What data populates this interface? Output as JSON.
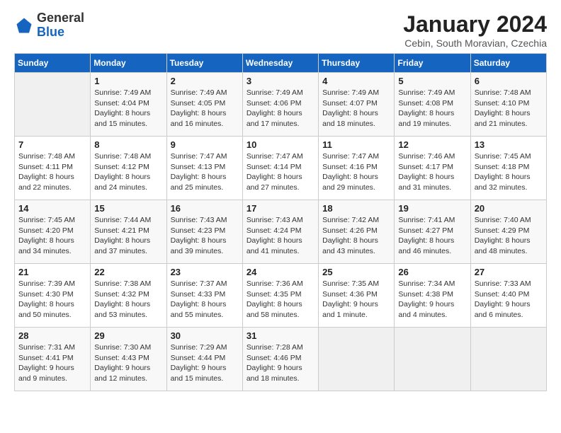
{
  "header": {
    "logo": {
      "general": "General",
      "blue": "Blue"
    },
    "title": "January 2024",
    "subtitle": "Cebin, South Moravian, Czechia"
  },
  "days_of_week": [
    "Sunday",
    "Monday",
    "Tuesday",
    "Wednesday",
    "Thursday",
    "Friday",
    "Saturday"
  ],
  "weeks": [
    [
      {
        "day": "",
        "info": ""
      },
      {
        "day": "1",
        "info": "Sunrise: 7:49 AM\nSunset: 4:04 PM\nDaylight: 8 hours\nand 15 minutes."
      },
      {
        "day": "2",
        "info": "Sunrise: 7:49 AM\nSunset: 4:05 PM\nDaylight: 8 hours\nand 16 minutes."
      },
      {
        "day": "3",
        "info": "Sunrise: 7:49 AM\nSunset: 4:06 PM\nDaylight: 8 hours\nand 17 minutes."
      },
      {
        "day": "4",
        "info": "Sunrise: 7:49 AM\nSunset: 4:07 PM\nDaylight: 8 hours\nand 18 minutes."
      },
      {
        "day": "5",
        "info": "Sunrise: 7:49 AM\nSunset: 4:08 PM\nDaylight: 8 hours\nand 19 minutes."
      },
      {
        "day": "6",
        "info": "Sunrise: 7:48 AM\nSunset: 4:10 PM\nDaylight: 8 hours\nand 21 minutes."
      }
    ],
    [
      {
        "day": "7",
        "info": "Sunrise: 7:48 AM\nSunset: 4:11 PM\nDaylight: 8 hours\nand 22 minutes."
      },
      {
        "day": "8",
        "info": "Sunrise: 7:48 AM\nSunset: 4:12 PM\nDaylight: 8 hours\nand 24 minutes."
      },
      {
        "day": "9",
        "info": "Sunrise: 7:47 AM\nSunset: 4:13 PM\nDaylight: 8 hours\nand 25 minutes."
      },
      {
        "day": "10",
        "info": "Sunrise: 7:47 AM\nSunset: 4:14 PM\nDaylight: 8 hours\nand 27 minutes."
      },
      {
        "day": "11",
        "info": "Sunrise: 7:47 AM\nSunset: 4:16 PM\nDaylight: 8 hours\nand 29 minutes."
      },
      {
        "day": "12",
        "info": "Sunrise: 7:46 AM\nSunset: 4:17 PM\nDaylight: 8 hours\nand 31 minutes."
      },
      {
        "day": "13",
        "info": "Sunrise: 7:45 AM\nSunset: 4:18 PM\nDaylight: 8 hours\nand 32 minutes."
      }
    ],
    [
      {
        "day": "14",
        "info": "Sunrise: 7:45 AM\nSunset: 4:20 PM\nDaylight: 8 hours\nand 34 minutes."
      },
      {
        "day": "15",
        "info": "Sunrise: 7:44 AM\nSunset: 4:21 PM\nDaylight: 8 hours\nand 37 minutes."
      },
      {
        "day": "16",
        "info": "Sunrise: 7:43 AM\nSunset: 4:23 PM\nDaylight: 8 hours\nand 39 minutes."
      },
      {
        "day": "17",
        "info": "Sunrise: 7:43 AM\nSunset: 4:24 PM\nDaylight: 8 hours\nand 41 minutes."
      },
      {
        "day": "18",
        "info": "Sunrise: 7:42 AM\nSunset: 4:26 PM\nDaylight: 8 hours\nand 43 minutes."
      },
      {
        "day": "19",
        "info": "Sunrise: 7:41 AM\nSunset: 4:27 PM\nDaylight: 8 hours\nand 46 minutes."
      },
      {
        "day": "20",
        "info": "Sunrise: 7:40 AM\nSunset: 4:29 PM\nDaylight: 8 hours\nand 48 minutes."
      }
    ],
    [
      {
        "day": "21",
        "info": "Sunrise: 7:39 AM\nSunset: 4:30 PM\nDaylight: 8 hours\nand 50 minutes."
      },
      {
        "day": "22",
        "info": "Sunrise: 7:38 AM\nSunset: 4:32 PM\nDaylight: 8 hours\nand 53 minutes."
      },
      {
        "day": "23",
        "info": "Sunrise: 7:37 AM\nSunset: 4:33 PM\nDaylight: 8 hours\nand 55 minutes."
      },
      {
        "day": "24",
        "info": "Sunrise: 7:36 AM\nSunset: 4:35 PM\nDaylight: 8 hours\nand 58 minutes."
      },
      {
        "day": "25",
        "info": "Sunrise: 7:35 AM\nSunset: 4:36 PM\nDaylight: 9 hours\nand 1 minute."
      },
      {
        "day": "26",
        "info": "Sunrise: 7:34 AM\nSunset: 4:38 PM\nDaylight: 9 hours\nand 4 minutes."
      },
      {
        "day": "27",
        "info": "Sunrise: 7:33 AM\nSunset: 4:40 PM\nDaylight: 9 hours\nand 6 minutes."
      }
    ],
    [
      {
        "day": "28",
        "info": "Sunrise: 7:31 AM\nSunset: 4:41 PM\nDaylight: 9 hours\nand 9 minutes."
      },
      {
        "day": "29",
        "info": "Sunrise: 7:30 AM\nSunset: 4:43 PM\nDaylight: 9 hours\nand 12 minutes."
      },
      {
        "day": "30",
        "info": "Sunrise: 7:29 AM\nSunset: 4:44 PM\nDaylight: 9 hours\nand 15 minutes."
      },
      {
        "day": "31",
        "info": "Sunrise: 7:28 AM\nSunset: 4:46 PM\nDaylight: 9 hours\nand 18 minutes."
      },
      {
        "day": "",
        "info": ""
      },
      {
        "day": "",
        "info": ""
      },
      {
        "day": "",
        "info": ""
      }
    ]
  ]
}
